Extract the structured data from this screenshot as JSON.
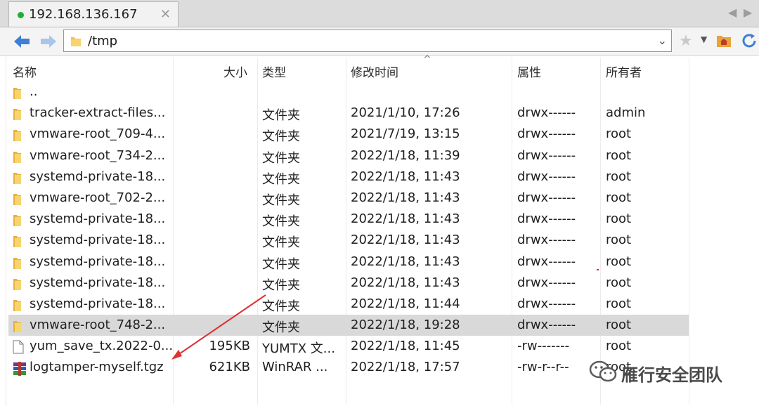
{
  "tab": {
    "title": "192.168.136.167",
    "close": "✕"
  },
  "tab_nav": {
    "left": "◀",
    "right": "▶"
  },
  "address": {
    "path": "/tmp",
    "dropdown": "⌄"
  },
  "columns": {
    "name": "名称",
    "size": "大小",
    "type": "类型",
    "modified": "修改时间",
    "attributes": "属性",
    "owner": "所有者"
  },
  "sort_indicator": "^",
  "files": [
    {
      "name": "..",
      "size": "",
      "type": "",
      "modified": "",
      "attributes": "",
      "owner": "",
      "icon": "folder-icon",
      "selected": false
    },
    {
      "name": "tracker-extract-files...",
      "size": "",
      "type": "文件夹",
      "modified": "2021/1/10, 17:26",
      "attributes": "drwx------",
      "owner": "admin",
      "icon": "folder-icon",
      "selected": false
    },
    {
      "name": "vmware-root_709-4...",
      "size": "",
      "type": "文件夹",
      "modified": "2021/7/19, 13:15",
      "attributes": "drwx------",
      "owner": "root",
      "icon": "folder-icon",
      "selected": false
    },
    {
      "name": "vmware-root_734-2...",
      "size": "",
      "type": "文件夹",
      "modified": "2022/1/18, 11:39",
      "attributes": "drwx------",
      "owner": "root",
      "icon": "folder-icon",
      "selected": false
    },
    {
      "name": "systemd-private-18...",
      "size": "",
      "type": "文件夹",
      "modified": "2022/1/18, 11:43",
      "attributes": "drwx------",
      "owner": "root",
      "icon": "folder-icon",
      "selected": false
    },
    {
      "name": "vmware-root_702-2...",
      "size": "",
      "type": "文件夹",
      "modified": "2022/1/18, 11:43",
      "attributes": "drwx------",
      "owner": "root",
      "icon": "folder-icon",
      "selected": false
    },
    {
      "name": "systemd-private-18...",
      "size": "",
      "type": "文件夹",
      "modified": "2022/1/18, 11:43",
      "attributes": "drwx------",
      "owner": "root",
      "icon": "folder-icon",
      "selected": false
    },
    {
      "name": "systemd-private-18...",
      "size": "",
      "type": "文件夹",
      "modified": "2022/1/18, 11:43",
      "attributes": "drwx------",
      "owner": "root",
      "icon": "folder-icon",
      "selected": false
    },
    {
      "name": "systemd-private-18...",
      "size": "",
      "type": "文件夹",
      "modified": "2022/1/18, 11:43",
      "attributes": "drwx------",
      "owner": "root",
      "icon": "folder-icon",
      "selected": false
    },
    {
      "name": "systemd-private-18...",
      "size": "",
      "type": "文件夹",
      "modified": "2022/1/18, 11:43",
      "attributes": "drwx------",
      "owner": "root",
      "icon": "folder-icon",
      "selected": false
    },
    {
      "name": "systemd-private-18...",
      "size": "",
      "type": "文件夹",
      "modified": "2022/1/18, 11:44",
      "attributes": "drwx------",
      "owner": "root",
      "icon": "folder-icon",
      "selected": false
    },
    {
      "name": "vmware-root_748-2...",
      "size": "",
      "type": "文件夹",
      "modified": "2022/1/18, 19:28",
      "attributes": "drwx------",
      "owner": "root",
      "icon": "folder-icon",
      "selected": true
    },
    {
      "name": "yum_save_tx.2022-0...",
      "size": "195KB",
      "type": "YUMTX 文...",
      "modified": "2022/1/18, 11:45",
      "attributes": "-rw-------",
      "owner": "root",
      "icon": "file-icon",
      "selected": false
    },
    {
      "name": "logtamper-myself.tgz",
      "size": "621KB",
      "type": "WinRAR ...",
      "modified": "2022/1/18, 17:57",
      "attributes": "-rw-r--r--",
      "owner": "root",
      "icon": "winrar-archive-icon",
      "selected": false
    }
  ],
  "watermark": "雁行安全团队",
  "colors": {
    "selected_row": "#d9d9d9",
    "annotation_arrow": "#e03030",
    "folder": "#f2c14e",
    "nav_arrow": "#3d7fd6"
  }
}
